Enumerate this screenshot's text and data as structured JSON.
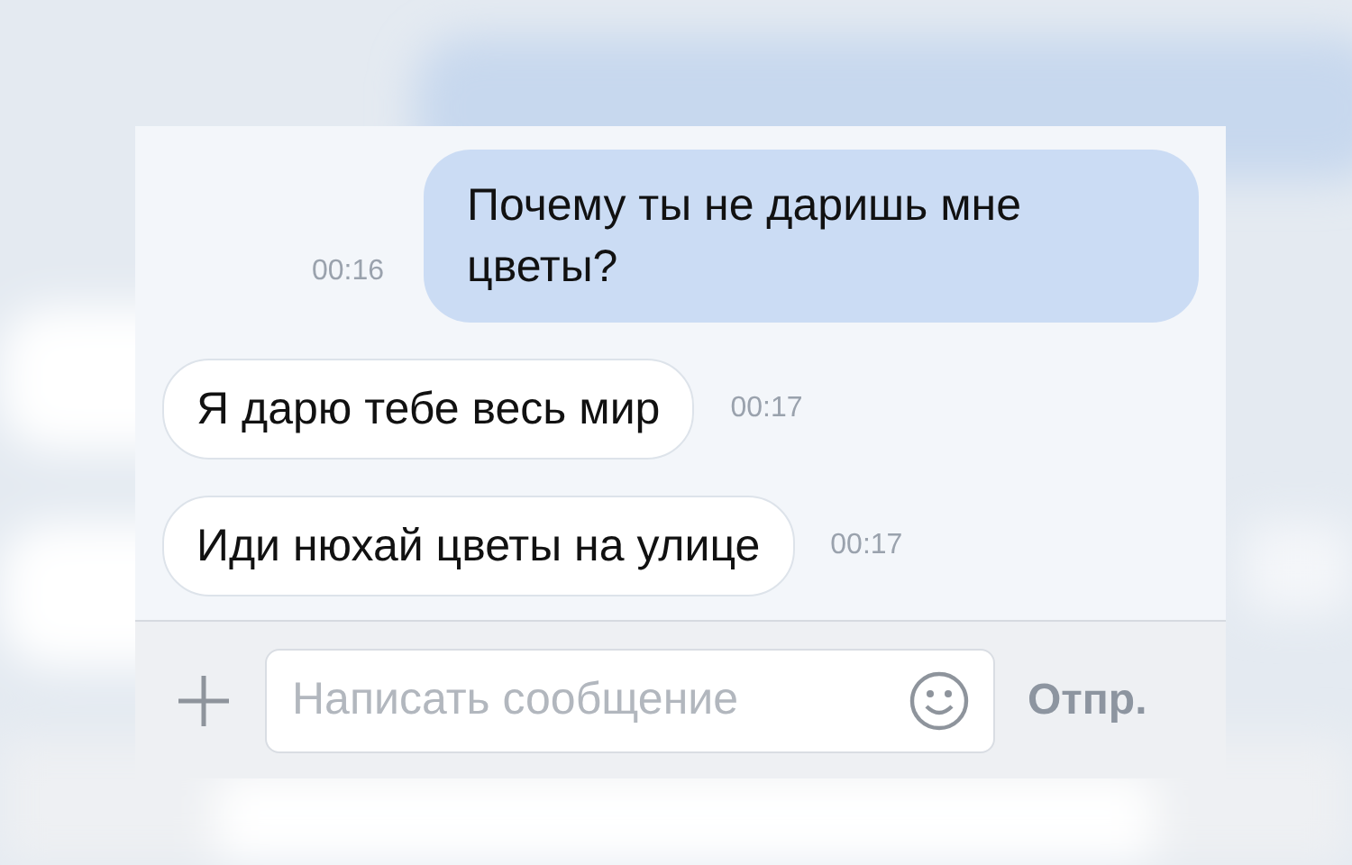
{
  "messages": [
    {
      "kind": "outgoing",
      "text": "Почему ты не даришь мне цветы?",
      "time": "00:16"
    },
    {
      "kind": "incoming",
      "text": "Я дарю тебе весь мир",
      "time": "00:17"
    },
    {
      "kind": "incoming",
      "text": "Иди нюхай цветы на улице",
      "time": "00:17"
    }
  ],
  "composer": {
    "placeholder": "Написать сообщение",
    "send_label": "Отпр."
  }
}
